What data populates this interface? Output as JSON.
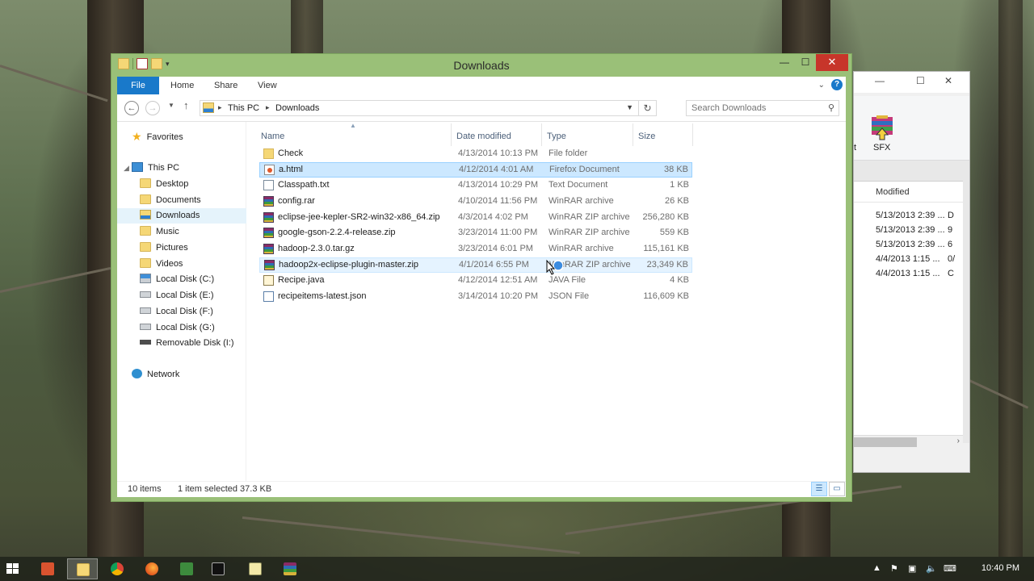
{
  "explorer": {
    "title": "Downloads",
    "ribbon_tabs": [
      "File",
      "Home",
      "Share",
      "View"
    ],
    "help_glyph": "?",
    "address": {
      "root": "This PC",
      "current": "Downloads"
    },
    "search_placeholder": "Search Downloads",
    "nav": {
      "favorites": "Favorites",
      "this_pc": "This PC",
      "pc_items": [
        "Desktop",
        "Documents",
        "Downloads",
        "Music",
        "Pictures",
        "Videos",
        "Local Disk (C:)",
        "Local Disk (E:)",
        "Local Disk (F:)",
        "Local Disk (G:)",
        "Removable Disk (I:)"
      ],
      "network": "Network"
    },
    "columns": {
      "name": "Name",
      "date": "Date modified",
      "type": "Type",
      "size": "Size"
    },
    "files": [
      {
        "name": "Check",
        "date": "4/13/2014 10:13 PM",
        "type": "File folder",
        "size": "",
        "icon": "folder-icon"
      },
      {
        "name": "a.html",
        "date": "4/12/2014 4:01 AM",
        "type": "Firefox Document",
        "size": "38 KB",
        "icon": "html-file-icon"
      },
      {
        "name": "Classpath.txt",
        "date": "4/13/2014 10:29 PM",
        "type": "Text Document",
        "size": "1 KB",
        "icon": "text-file-icon"
      },
      {
        "name": "config.rar",
        "date": "4/10/2014 11:56 PM",
        "type": "WinRAR archive",
        "size": "26 KB",
        "icon": "winrar-archive-icon"
      },
      {
        "name": "eclipse-jee-kepler-SR2-win32-x86_64.zip",
        "date": "4/3/2014 4:02 PM",
        "type": "WinRAR ZIP archive",
        "size": "256,280 KB",
        "icon": "winrar-archive-icon"
      },
      {
        "name": "google-gson-2.2.4-release.zip",
        "date": "3/23/2014 11:00 PM",
        "type": "WinRAR ZIP archive",
        "size": "559 KB",
        "icon": "winrar-archive-icon"
      },
      {
        "name": "hadoop-2.3.0.tar.gz",
        "date": "3/23/2014 6:01 PM",
        "type": "WinRAR archive",
        "size": "115,161 KB",
        "icon": "winrar-archive-icon"
      },
      {
        "name": "hadoop2x-eclipse-plugin-master.zip",
        "date": "4/1/2014 6:55 PM",
        "type": "WinRAR ZIP archive",
        "size": "23,349 KB",
        "icon": "winrar-archive-icon"
      },
      {
        "name": "Recipe.java",
        "date": "4/12/2014 12:51 AM",
        "type": "JAVA File",
        "size": "4 KB",
        "icon": "java-file-icon"
      },
      {
        "name": "recipeitems-latest.json",
        "date": "3/14/2014 10:20 PM",
        "type": "JSON File",
        "size": "116,609 KB",
        "icon": "json-file-icon"
      }
    ],
    "status": {
      "count": "10 items",
      "selection": "1 item selected  37.3 KB"
    }
  },
  "background_window": {
    "toolbar_label": "SFX",
    "partial_label": "t",
    "column": "Modified",
    "rows": [
      {
        "date": "5/13/2013 2:39 ...",
        "extra": "D"
      },
      {
        "date": "5/13/2013 2:39 ...",
        "extra": "9"
      },
      {
        "date": "5/13/2013 2:39 ...",
        "extra": "6"
      },
      {
        "date": "4/4/2013 1:15 ...",
        "extra": "0/"
      },
      {
        "date": "4/4/2013 1:15 ...",
        "extra": "C"
      }
    ]
  },
  "taskbar": {
    "time": "10:40 PM",
    "apps": [
      "start-button",
      "app-icon",
      "file-explorer-icon",
      "chrome-icon",
      "firefox-icon",
      "spreadsheet-icon",
      "command-prompt-icon",
      "notepad-icon",
      "winrar-icon"
    ]
  },
  "colors": {
    "window_frame": "#9ac078",
    "accent": "#1979ca",
    "selection": "#cce8ff",
    "close": "#c7352a"
  }
}
